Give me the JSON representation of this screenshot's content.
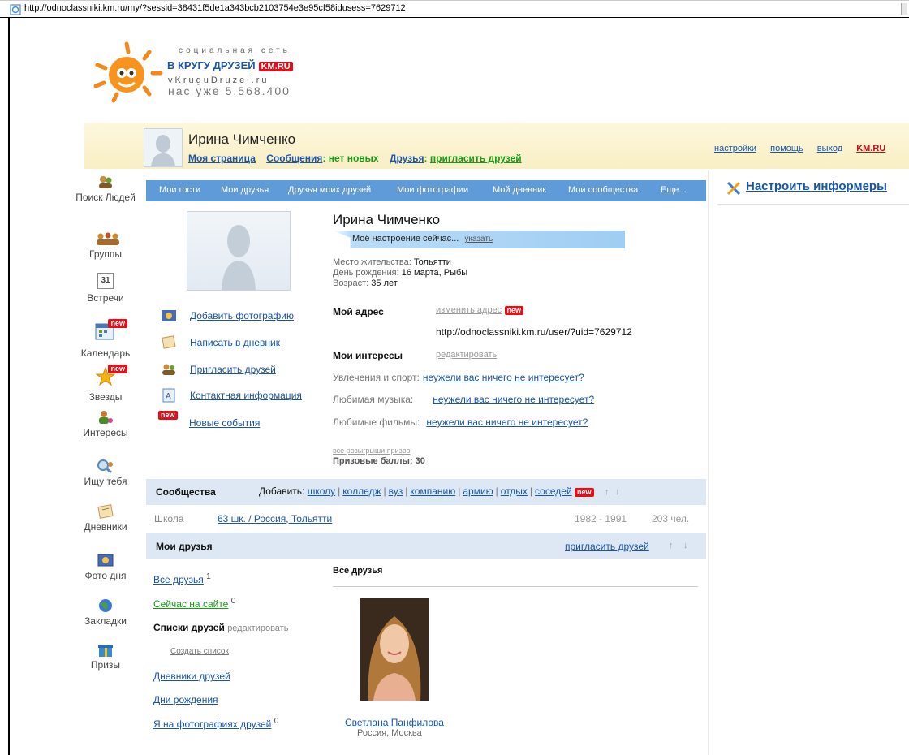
{
  "browser": {
    "url": "http://odnoclassniki.km.ru/my/?sessid=38431f5de1a343bcb2103754e3e95cf58idusess=7629712"
  },
  "logo": {
    "tagline": "социальная сеть",
    "title": "В КРУГУ ДРУЗЕЙ",
    "badge": "KM.RU",
    "site": "vKruguDruzei.ru",
    "count": "нас уже 5.568.400"
  },
  "header": {
    "user_name": "Ирина Чимченко",
    "my_page": "Моя страница",
    "messages": "Сообщения",
    "messages_status": ": нет новых",
    "friends": "Друзья",
    "friends_sep": ":",
    "invite": "пригласить друзей",
    "settings": "настройки",
    "help": "помощь",
    "logout": "выход",
    "kmru": "KM.RU"
  },
  "sidebar": {
    "new_badge": "new",
    "items": [
      {
        "label": "Поиск Людей",
        "icon": "people-search-icon"
      },
      {
        "label": "Группы",
        "icon": "groups-icon"
      },
      {
        "label": "Встречи",
        "icon": "calendar-31-icon",
        "icon_text": "31"
      },
      {
        "label": "Календарь",
        "icon": "calendar-icon"
      },
      {
        "label": "Звезды",
        "icon": "star-icon"
      },
      {
        "label": "Интересы",
        "icon": "interests-icon"
      },
      {
        "label": "Ищу тебя",
        "icon": "search-person-icon"
      },
      {
        "label": "Дневники",
        "icon": "diary-icon"
      },
      {
        "label": "Фото дня",
        "icon": "photo-icon"
      },
      {
        "label": "Закладки",
        "icon": "bookmark-globe-icon"
      },
      {
        "label": "Призы",
        "icon": "gift-icon"
      }
    ]
  },
  "tabs": [
    "Мои гости",
    "Мои друзья",
    "Друзья моих друзей",
    "Мои фотографии",
    "Мой дневник",
    "Мои сообщества",
    "Еще..."
  ],
  "actions": [
    {
      "label": "Добавить фотографию",
      "icon": "add-photo-icon"
    },
    {
      "label": "Написать в дневник",
      "icon": "diary-write-icon"
    },
    {
      "label": "Пригласить друзей",
      "icon": "invite-friends-icon"
    },
    {
      "label": "Контактная информация",
      "icon": "contact-info-icon"
    },
    {
      "label": "Новые события",
      "icon": "new-events-icon"
    }
  ],
  "profile": {
    "name": "Ирина Чимченко",
    "mood_label": "Моё настроение сейчас...",
    "mood_link": "указать",
    "residence_label": "Место жительства:",
    "residence": "Тольятти",
    "birthday_label": "День рождения:",
    "birthday": "16 марта, Рыбы",
    "age_label": "Возраст:",
    "age": "35 лет",
    "address_title": "Мой адрес",
    "address_change": "изменить адрес",
    "address_url": "http://odnoclassniki.km.ru/user/?uid=7629712",
    "interests_title": "Мои интересы",
    "interests_edit": "редактировать",
    "hobbies_label": "Увлечения и спорт:",
    "music_label": "Любимая музыка:",
    "films_label": "Любимые фильмы:",
    "no_interest": "неужели вас ничего не интересует?",
    "prizes_link": "все розыгрыши призов",
    "prize_points": "Призовые баллы: 30"
  },
  "communities": {
    "title": "Сообщества",
    "add_label": "Добавить:",
    "links": [
      "школу",
      "колледж",
      "вуз",
      "компанию",
      "армию",
      "отдых",
      "соседей"
    ],
    "row": {
      "type": "Школа",
      "name": "63 шк. / Россия, Тольятти",
      "years": "1982 - 1991",
      "members": "203 чел."
    }
  },
  "friends": {
    "title": "Мои друзья",
    "invite": "пригласить друзей",
    "all": "Все друзья",
    "all_count": "1",
    "online": "Сейчас на сайте",
    "online_count": "0",
    "lists": "Списки друзей",
    "lists_edit": "редактировать",
    "create_list": "Создать список",
    "diaries": "Дневники друзей",
    "birthdays": "Дни рождения",
    "on_photos": "Я на фотографиях друзей",
    "on_photos_count": "0",
    "all_heading": "Все друзья",
    "friend_name": "Светлана Панфилова",
    "friend_location": "Россия, Москва"
  },
  "informers": {
    "label": "Настроить информеры"
  }
}
